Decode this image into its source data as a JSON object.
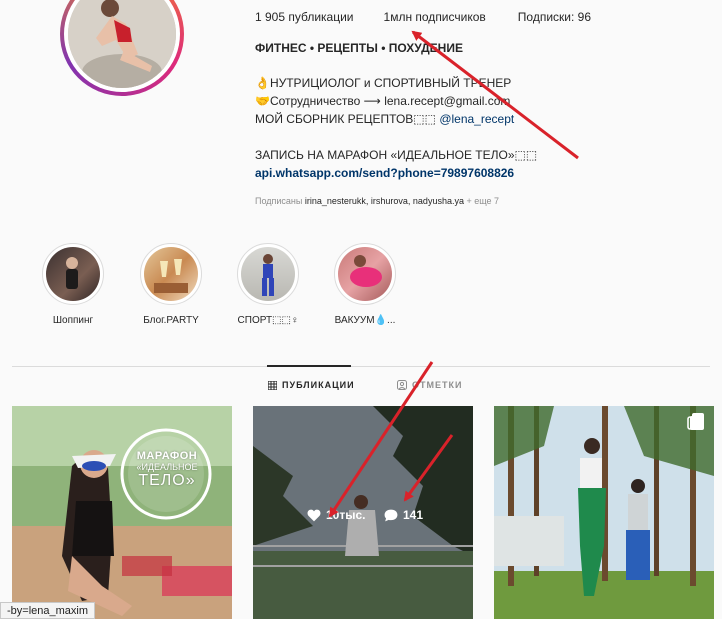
{
  "profile": {
    "stats": {
      "posts": "1 905 публикации",
      "followers": "1млн подписчиков",
      "following": "Подписки: 96"
    },
    "bio": {
      "headline": "ФИТНЕС • РЕЦЕПТЫ • ПОХУДЕНИЕ",
      "line1": "👌НУТРИЦИОЛОГ и СПОРТИВНЫЙ ТРЕНЕР",
      "line2": "🤝Сотрудничество ⟶ lena.recept@gmail.com",
      "line3_prefix": "МОЙ СБОРНИК РЕЦЕПТОВ⬚⬚ ",
      "line3_link": "@lena_recept",
      "line4": "ЗАПИСЬ НА МАРАФОН «ИДЕАЛЬНОЕ ТЕЛО»⬚⬚",
      "website": "api.whatsapp.com/send?phone=79897608826",
      "followed_by_prefix": "Подписаны ",
      "followed_by_names": "irina_nesterukk, irshurova, nadyusha.ya",
      "followed_by_more": " + еще 7"
    }
  },
  "highlights": [
    {
      "label": "Шоппинг"
    },
    {
      "label": "Блог.PARTY"
    },
    {
      "label": "СПОРТ⬚⬚♀"
    },
    {
      "label": "ВАКУУМ💧..."
    }
  ],
  "tabs": {
    "posts": "ПУБЛИКАЦИИ",
    "tagged": "ОТМЕТКИ"
  },
  "posts": [
    {
      "overlay_title_1": "МАРАФОН",
      "overlay_title_2": "«ИДЕАЛЬНОЕ",
      "overlay_title_3": "ТЕЛО»"
    },
    {
      "likes": "10тыс.",
      "comments": "141"
    },
    {}
  ],
  "tooltip": "-by=lena_maxim",
  "colors": {
    "arrow": "#d9222a",
    "link": "#003569",
    "muted": "#8e8e8e"
  }
}
